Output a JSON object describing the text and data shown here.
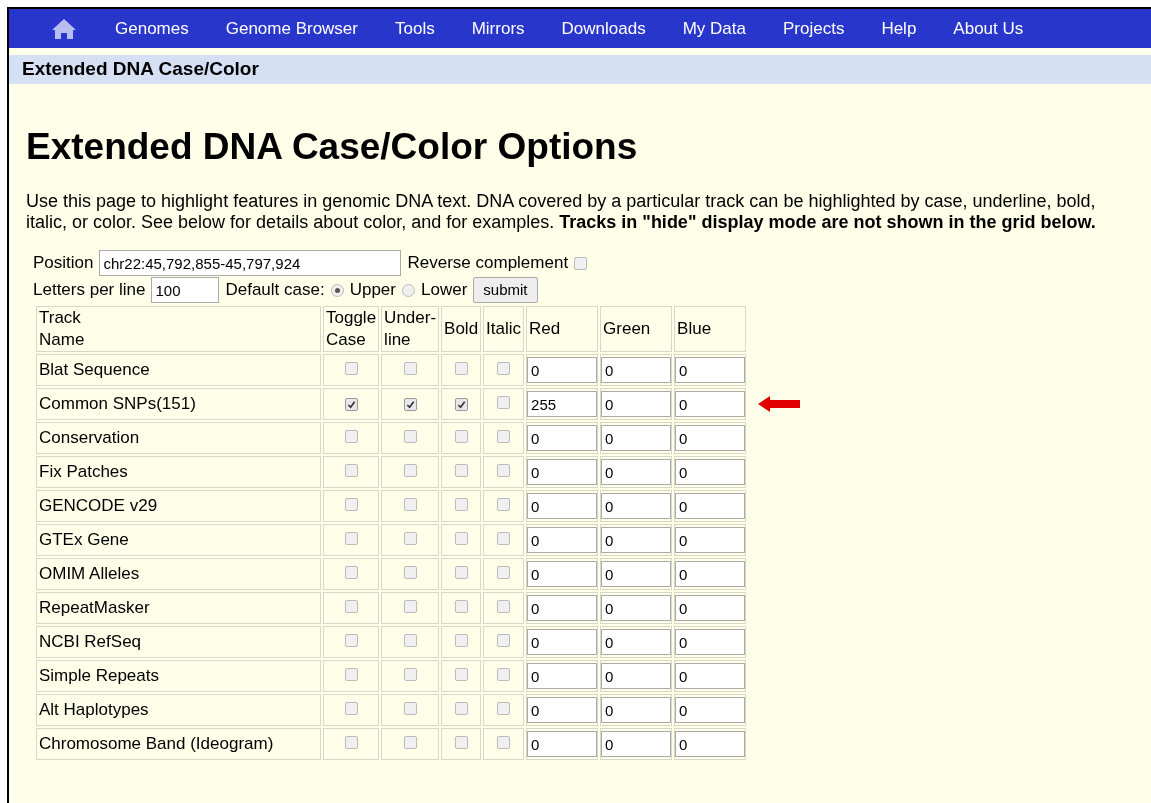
{
  "nav": {
    "items": [
      "Genomes",
      "Genome Browser",
      "Tools",
      "Mirrors",
      "Downloads",
      "My Data",
      "Projects",
      "Help",
      "About Us"
    ]
  },
  "section_bar": {
    "title": "Extended DNA Case/Color"
  },
  "heading": "Extended DNA Case/Color Options",
  "intro": "Use this page to highlight features in genomic DNA text. DNA covered by a particular track can be highlighted by case, underline, bold, italic, or color. See below for details about color, and for examples. **Tracks in \"hide\" display mode are not shown in the grid below.**",
  "form": {
    "position_label": "Position",
    "position": "chr22:45,792,855-45,797,924",
    "reverse_label": "Reverse complement",
    "reverse_checked": false,
    "letters_label": "Letters per line",
    "letters": "100",
    "case_label": "Default case:",
    "case_options": [
      {
        "label": "Upper",
        "selected": true
      },
      {
        "label": "Lower",
        "selected": false
      }
    ],
    "submit": "submit"
  },
  "table": {
    "columns": [
      "Track\nName",
      "Toggle\nCase",
      "Under-\nline",
      "Bold",
      "Italic",
      "Red",
      "Green",
      "Blue"
    ],
    "rows": [
      {
        "name": "Blat Sequence",
        "toggle_case": false,
        "underline": false,
        "bold": false,
        "italic": false,
        "red": "0",
        "green": "0",
        "blue": "0",
        "pointed": false
      },
      {
        "name": "Common SNPs(151)",
        "toggle_case": true,
        "underline": true,
        "bold": true,
        "italic": false,
        "red": "255",
        "green": "0",
        "blue": "0",
        "pointed": true
      },
      {
        "name": "Conservation",
        "toggle_case": false,
        "underline": false,
        "bold": false,
        "italic": false,
        "red": "0",
        "green": "0",
        "blue": "0",
        "pointed": false
      },
      {
        "name": "Fix Patches",
        "toggle_case": false,
        "underline": false,
        "bold": false,
        "italic": false,
        "red": "0",
        "green": "0",
        "blue": "0",
        "pointed": false
      },
      {
        "name": "GENCODE v29",
        "toggle_case": false,
        "underline": false,
        "bold": false,
        "italic": false,
        "red": "0",
        "green": "0",
        "blue": "0",
        "pointed": false
      },
      {
        "name": "GTEx Gene",
        "toggle_case": false,
        "underline": false,
        "bold": false,
        "italic": false,
        "red": "0",
        "green": "0",
        "blue": "0",
        "pointed": false
      },
      {
        "name": "OMIM Alleles",
        "toggle_case": false,
        "underline": false,
        "bold": false,
        "italic": false,
        "red": "0",
        "green": "0",
        "blue": "0",
        "pointed": false
      },
      {
        "name": "RepeatMasker",
        "toggle_case": false,
        "underline": false,
        "bold": false,
        "italic": false,
        "red": "0",
        "green": "0",
        "blue": "0",
        "pointed": false
      },
      {
        "name": "NCBI RefSeq",
        "toggle_case": false,
        "underline": false,
        "bold": false,
        "italic": false,
        "red": "0",
        "green": "0",
        "blue": "0",
        "pointed": false
      },
      {
        "name": "Simple Repeats",
        "toggle_case": false,
        "underline": false,
        "bold": false,
        "italic": false,
        "red": "0",
        "green": "0",
        "blue": "0",
        "pointed": false
      },
      {
        "name": "Alt Haplotypes",
        "toggle_case": false,
        "underline": false,
        "bold": false,
        "italic": false,
        "red": "0",
        "green": "0",
        "blue": "0",
        "pointed": false
      },
      {
        "name": "Chromosome Band (Ideogram)",
        "toggle_case": false,
        "underline": false,
        "bold": false,
        "italic": false,
        "red": "0",
        "green": "0",
        "blue": "0",
        "pointed": false
      }
    ]
  }
}
